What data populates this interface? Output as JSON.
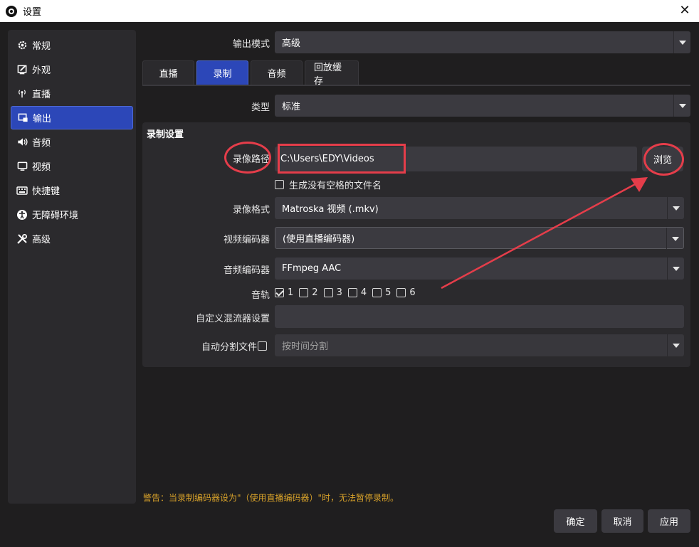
{
  "window": {
    "title": "设置"
  },
  "sidebar": {
    "items": [
      {
        "label": "常规",
        "icon": "gear-icon"
      },
      {
        "label": "外观",
        "icon": "appearance-icon"
      },
      {
        "label": "直播",
        "icon": "broadcast-icon"
      },
      {
        "label": "输出",
        "icon": "output-icon",
        "active": true
      },
      {
        "label": "音频",
        "icon": "speaker-icon"
      },
      {
        "label": "视频",
        "icon": "monitor-icon"
      },
      {
        "label": "快捷键",
        "icon": "keyboard-icon"
      },
      {
        "label": "无障碍环境",
        "icon": "accessibility-icon"
      },
      {
        "label": "高级",
        "icon": "tools-icon"
      }
    ]
  },
  "output_mode": {
    "label": "输出模式",
    "value": "高级"
  },
  "tabs": [
    {
      "label": "直播"
    },
    {
      "label": "录制",
      "active": true
    },
    {
      "label": "音频"
    },
    {
      "label": "回放缓存"
    }
  ],
  "type": {
    "label": "类型",
    "value": "标准"
  },
  "recording": {
    "group_title": "录制设置",
    "path_label": "录像路径",
    "path_value": "C:\\Users\\EDY\\Videos",
    "browse_label": "浏览",
    "no_space_label": "生成没有空格的文件名",
    "format_label": "录像格式",
    "format_value": "Matroska 视频 (.mkv)",
    "video_encoder_label": "视频编码器",
    "video_encoder_value": "(使用直播编码器)",
    "audio_encoder_label": "音频编码器",
    "audio_encoder_value": "FFmpeg AAC",
    "tracks_label": "音轨",
    "tracks": [
      {
        "num": "1",
        "checked": true
      },
      {
        "num": "2",
        "checked": false
      },
      {
        "num": "3",
        "checked": false
      },
      {
        "num": "4",
        "checked": false
      },
      {
        "num": "5",
        "checked": false
      },
      {
        "num": "6",
        "checked": false
      }
    ],
    "muxer_label": "自定义混流器设置",
    "muxer_value": "",
    "split_label": "自动分割文件",
    "split_value": "按时间分割"
  },
  "warning": "警告：当录制编码器设为\"（使用直播编码器）\"时，无法暂停录制。",
  "footer": {
    "ok": "确定",
    "cancel": "取消",
    "apply": "应用"
  },
  "colors": {
    "accent": "#2c47b8",
    "annotation": "#e53d4a",
    "warning": "#d8a22a"
  }
}
